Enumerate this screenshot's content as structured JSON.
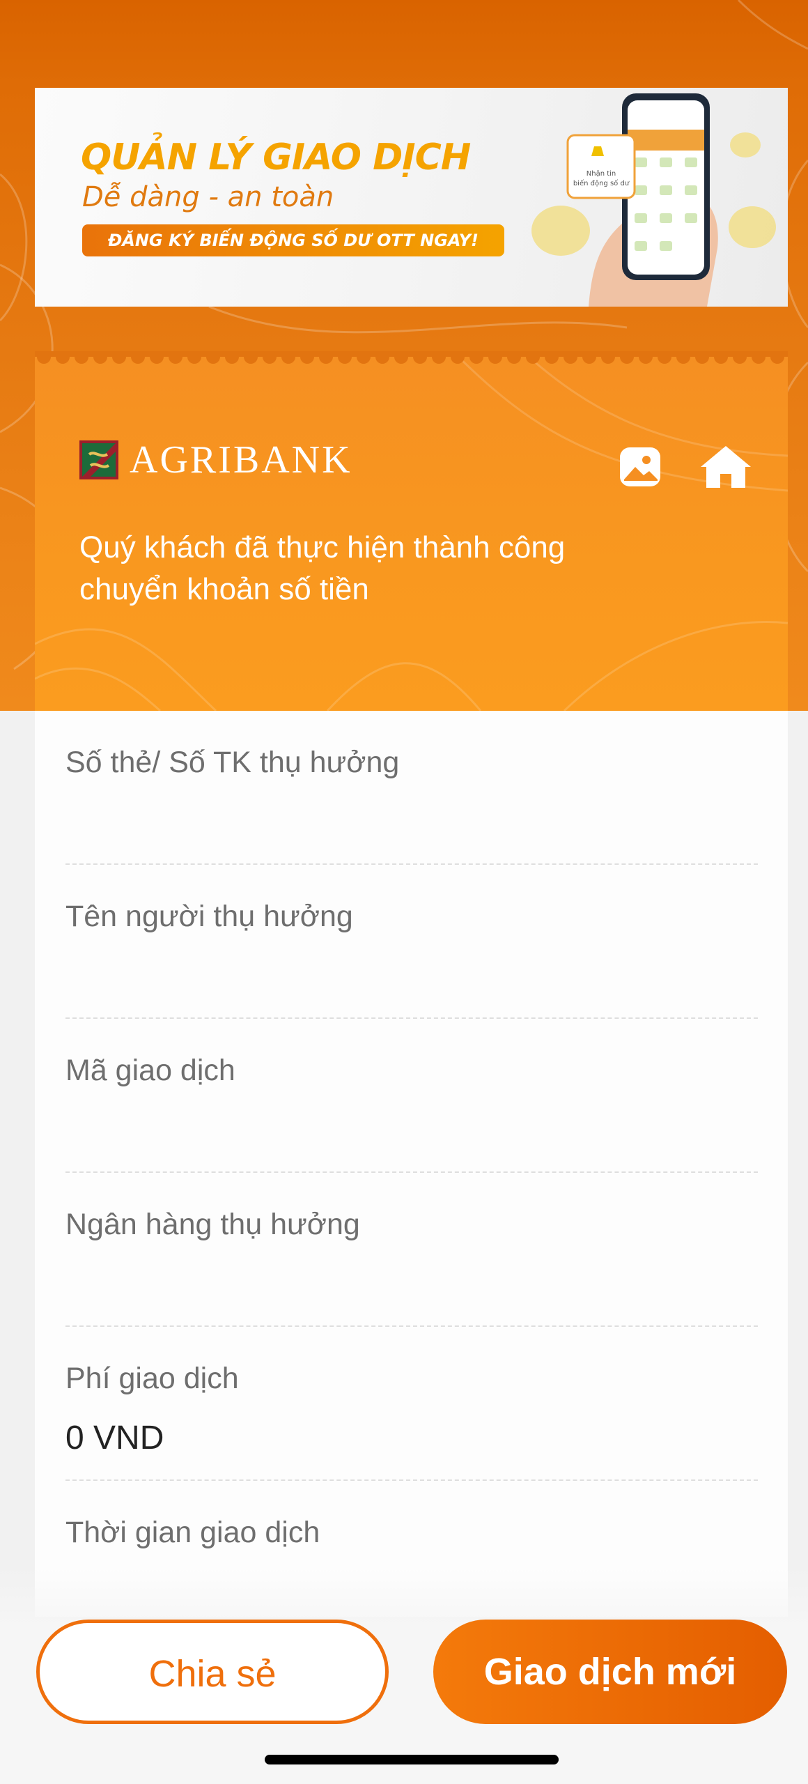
{
  "banner": {
    "title": "QUẢN LÝ GIAO DỊCH",
    "subtitle": "Dễ dàng - an toàn",
    "cta": "ĐĂNG KÝ BIẾN ĐỘNG SỐ DƯ OTT NGAY!",
    "phone_popup_text": "Nhận tin biến động số dư"
  },
  "header": {
    "brand_name": "AGRIBANK",
    "success_message": "Quý khách đã thực hiện thành công chuyển khoản số tiền"
  },
  "details": {
    "fields": [
      {
        "label": "Số thẻ/ Số TK thụ hưởng",
        "value": ""
      },
      {
        "label": "Tên người thụ hưởng",
        "value": ""
      },
      {
        "label": "Mã giao dịch",
        "value": ""
      },
      {
        "label": "Ngân hàng thụ hưởng",
        "value": ""
      },
      {
        "label": "Phí giao dịch",
        "value": "0 VND"
      },
      {
        "label": "Thời gian giao dịch",
        "value": ""
      }
    ]
  },
  "actions": {
    "share_label": "Chia sẻ",
    "new_transaction_label": "Giao dịch mới"
  },
  "colors": {
    "primary_orange": "#ef6f0c",
    "header_orange": "#f9981f",
    "banner_title": "#f5a300"
  }
}
